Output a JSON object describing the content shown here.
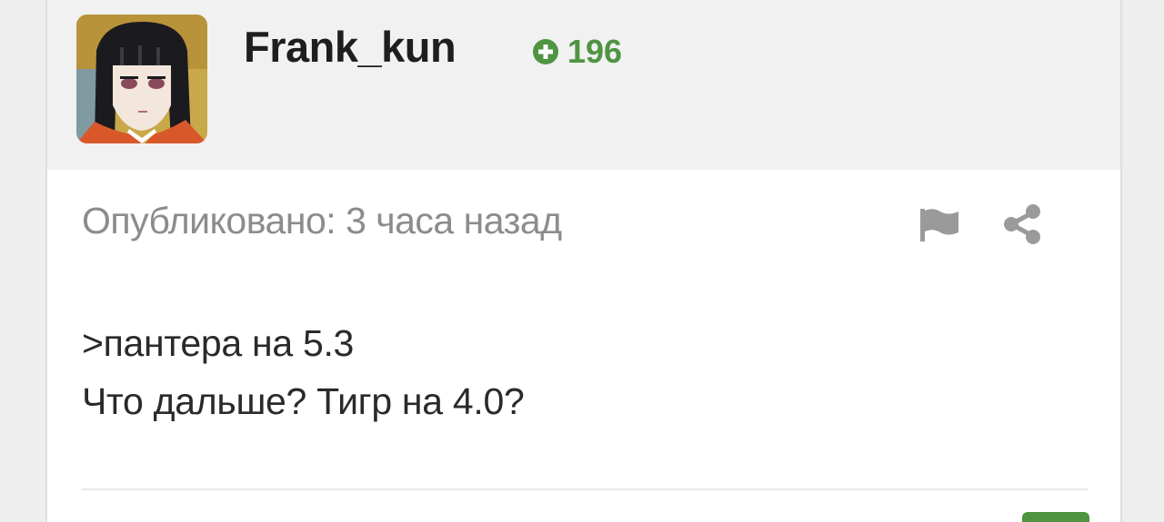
{
  "post": {
    "author": {
      "username": "Frank_kun",
      "reputation": "196",
      "avatar_icon": "anime-girl-avatar"
    },
    "published_text": "Опубликовано: 3 часа назад",
    "actions": {
      "report_icon": "flag-icon",
      "share_icon": "share-icon"
    },
    "body_lines": [
      ">пантера на 5.3",
      "Что дальше? Тигр на 4.0?"
    ]
  },
  "colors": {
    "accent": "#4f9441",
    "header_bg": "#f1f1f1",
    "meta_text": "#8c8c8c"
  }
}
